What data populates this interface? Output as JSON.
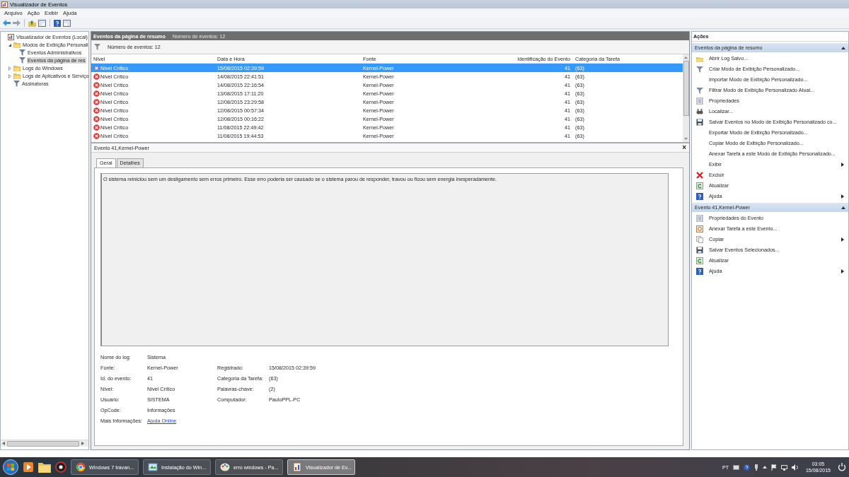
{
  "window": {
    "title": "Visualizador de Eventos"
  },
  "menu": [
    "Arquivo",
    "Ação",
    "Exibir",
    "Ajuda"
  ],
  "tree": [
    {
      "label": "Visualizador de Eventos (Local)",
      "selected": false,
      "children": [
        {
          "label": "Modos de Exibição Personali",
          "selected": false,
          "expanded": true,
          "children": [
            {
              "label": "Eventos Administrativos",
              "selected": false
            },
            {
              "label": "Eventos da página de res",
              "selected": true
            }
          ]
        },
        {
          "label": "Logs do Windows",
          "selected": false,
          "expanded": false
        },
        {
          "label": "Logs de Aplicativos e Serviço",
          "selected": false,
          "expanded": false
        },
        {
          "label": "Assinaturas",
          "selected": false
        }
      ]
    }
  ],
  "center": {
    "title": "Eventos da página de resumo",
    "count": "Número de eventos: 12",
    "filter_text": "Número de eventos: 12"
  },
  "table": {
    "columns": [
      "Nível",
      "Data e Hora",
      "Fonte",
      "Identificação do Evento",
      "Categoria da Tarefa"
    ],
    "rows": [
      {
        "level": "Nível Crítico",
        "date": "15/08/2015 02:39:59",
        "source": "Kernel-Power",
        "id": "41",
        "category": "(63)",
        "selected": true
      },
      {
        "level": "Nível Crítico",
        "date": "14/08/2015 22:41:51",
        "source": "Kernel-Power",
        "id": "41",
        "category": "(63)",
        "selected": false
      },
      {
        "level": "Nível Crítico",
        "date": "14/08/2015 22:16:54",
        "source": "Kernel-Power",
        "id": "41",
        "category": "(63)",
        "selected": false
      },
      {
        "level": "Nível Crítico",
        "date": "13/08/2015 17:11:20",
        "source": "Kernel-Power",
        "id": "41",
        "category": "(63)",
        "selected": false
      },
      {
        "level": "Nível Crítico",
        "date": "12/08/2015 23:29:58",
        "source": "Kernel-Power",
        "id": "41",
        "category": "(63)",
        "selected": false
      },
      {
        "level": "Nível Crítico",
        "date": "12/08/2015 00:57:34",
        "source": "Kernel-Power",
        "id": "41",
        "category": "(63)",
        "selected": false
      },
      {
        "level": "Nível Crítico",
        "date": "12/08/2015 00:16:22",
        "source": "Kernel-Power",
        "id": "41",
        "category": "(63)",
        "selected": false
      },
      {
        "level": "Nível Crítico",
        "date": "11/08/2015 22:49:42",
        "source": "Kernel-Power",
        "id": "41",
        "category": "(63)",
        "selected": false
      },
      {
        "level": "Nível Crítico",
        "date": "11/08/2015 19:44:53",
        "source": "Kernel-Power",
        "id": "41",
        "category": "(63)",
        "selected": false
      }
    ]
  },
  "detail": {
    "title": "Evento 41,Kernel-Power",
    "close": "×",
    "tabs": [
      {
        "label": "Geral",
        "selected": true
      },
      {
        "label": "Detalhes",
        "selected": false
      }
    ],
    "description": "O sistema reiniciou sem um desligamento sem erros primeiro. Esse erro poderia ser causado se o sistema parou de responder, travou ou ficou sem energia inesperadamente.",
    "fields_left": [
      {
        "label": "Nome do log:",
        "value": "Sistema"
      },
      {
        "label": "Fonte:",
        "value": "Kernel-Power"
      },
      {
        "label": "Id. do evento:",
        "value": "41"
      },
      {
        "label": "Nível:",
        "value": "Nível Crítico"
      },
      {
        "label": "Usuário:",
        "value": "SISTEMA"
      },
      {
        "label": "OpCode:",
        "value": "Informações"
      }
    ],
    "fields_right": [
      {
        "label": "Registrado:",
        "value": "15/08/2015 02:39:59"
      },
      {
        "label": "Categoria da Tarefa:",
        "value": "(63)"
      },
      {
        "label": "Palavras-chave:",
        "value": "(2)"
      },
      {
        "label": "Computador:",
        "value": "PauloPPL-PC"
      }
    ],
    "more_info": {
      "label": "Mais Informações:",
      "link": "Ajuda Online"
    }
  },
  "actions": {
    "title": "Ações",
    "sections": [
      {
        "title": "Eventos da página de resumo",
        "expanded": true,
        "items": [
          {
            "label": "Abrir Log Salvo...",
            "kind": "folder",
            "submenu": false
          },
          {
            "label": "Criar Modo de Exibição Personalizado...",
            "kind": "filter",
            "submenu": false
          },
          {
            "label": "Importar Modo de Exibição Personalizado...",
            "kind": "plain",
            "submenu": false
          },
          {
            "label": "Filtrar Modo de Exibição Personalizado Atual...",
            "kind": "filter",
            "submenu": false
          },
          {
            "label": "Propriedades",
            "kind": "properties",
            "submenu": false
          },
          {
            "label": "Localizar...",
            "kind": "find",
            "submenu": false
          },
          {
            "label": "Salvar Eventos no Modo de Exibição Personalizado co...",
            "kind": "save",
            "submenu": false
          },
          {
            "label": "Exportar Modo de Exibição Personalizado...",
            "kind": "plain",
            "submenu": false
          },
          {
            "label": "Copiar Modo de Exibição Personalizado...",
            "kind": "plain",
            "submenu": false
          },
          {
            "label": "Anexar Tarefa a este Modo de Exibição Personalizado...",
            "kind": "plain",
            "submenu": false
          },
          {
            "label": "Exibir",
            "kind": "plain",
            "submenu": true
          },
          {
            "label": "Excluir",
            "kind": "delete",
            "submenu": false
          },
          {
            "label": "Atualizar",
            "kind": "refresh",
            "submenu": false
          },
          {
            "label": "Ajuda",
            "kind": "help",
            "submenu": true
          }
        ]
      },
      {
        "title": "Evento 41,Kernel-Power",
        "expanded": true,
        "items": [
          {
            "label": "Propriedades do Evento",
            "kind": "properties",
            "submenu": false
          },
          {
            "label": "Anexar Tarefa a este Evento...",
            "kind": "task",
            "submenu": false
          },
          {
            "label": "Copiar",
            "kind": "copy",
            "submenu": true
          },
          {
            "label": "Salvar Eventos Selecionados...",
            "kind": "save",
            "submenu": false
          },
          {
            "label": "Atualizar",
            "kind": "refresh",
            "submenu": false
          },
          {
            "label": "Ajuda",
            "kind": "help",
            "submenu": true
          }
        ]
      }
    ]
  },
  "taskbar": {
    "tasks": [
      {
        "label": "Windows 7 travan...",
        "kind": "browser",
        "selected": false
      },
      {
        "label": "Instalação do Win...",
        "kind": "editor",
        "selected": false
      },
      {
        "label": "erro windows - Pa...",
        "kind": "paint",
        "selected": false
      },
      {
        "label": "Visualizador de Ev...",
        "kind": "viewer",
        "selected": true
      }
    ],
    "language": "PT",
    "time": "03:05",
    "date": "15/08/2015"
  }
}
